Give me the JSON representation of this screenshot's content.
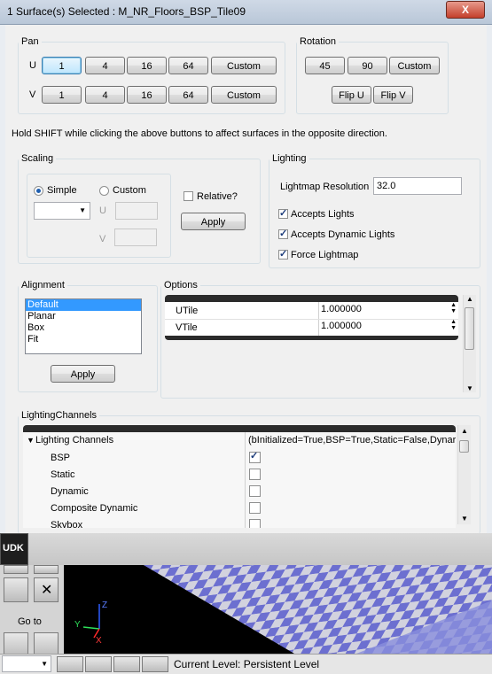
{
  "window": {
    "title": "1 Surface(s) Selected : M_NR_Floors_BSP_Tile09",
    "close_label": "X"
  },
  "pan": {
    "legend": "Pan",
    "u_label": "U",
    "v_label": "V",
    "u_buttons": [
      "1",
      "4",
      "16",
      "64",
      "Custom"
    ],
    "v_buttons": [
      "1",
      "4",
      "16",
      "64",
      "Custom"
    ]
  },
  "rotation": {
    "legend": "Rotation",
    "buttons": [
      "45",
      "90",
      "Custom"
    ],
    "flip_u": "Flip U",
    "flip_v": "Flip V"
  },
  "hint": "Hold SHIFT while clicking the above buttons to affect surfaces in the opposite direction.",
  "scaling": {
    "legend": "Scaling",
    "simple_label": "Simple",
    "custom_label": "Custom",
    "relative_label": "Relative?",
    "u_label": "U",
    "v_label": "V",
    "apply_label": "Apply",
    "mode": "Simple"
  },
  "lighting": {
    "legend": "Lighting",
    "resolution_label": "Lightmap Resolution",
    "resolution_value": "32.0",
    "accepts_lights": "Accepts Lights",
    "accepts_dynamic": "Accepts Dynamic Lights",
    "force_lightmap": "Force Lightmap"
  },
  "alignment": {
    "legend": "Alignment",
    "items": [
      "Default",
      "Planar",
      "Box",
      "Fit"
    ],
    "selected": "Default",
    "apply_label": "Apply"
  },
  "options": {
    "legend": "Options",
    "rows": [
      {
        "name": "UTile",
        "value": "1.000000"
      },
      {
        "name": "VTile",
        "value": "1.000000"
      }
    ]
  },
  "lighting_channels": {
    "legend": "LightingChannels",
    "root_label": "Lighting Channels",
    "root_value": "(bInitialized=True,BSP=True,Static=False,Dynar",
    "items": [
      {
        "name": "BSP",
        "checked": true
      },
      {
        "name": "Static",
        "checked": false
      },
      {
        "name": "Dynamic",
        "checked": false
      },
      {
        "name": "Composite Dynamic",
        "checked": false
      },
      {
        "name": "Skybox",
        "checked": false
      }
    ]
  },
  "editor": {
    "logo_label": "UDK",
    "go_to_label": "Go to",
    "axis_x": "X",
    "axis_y": "Y",
    "axis_z": "Z",
    "current_level": "Current Level:  Persistent Level"
  },
  "colors": {
    "accent": "#3399ff",
    "checker_a": "#6c6fd0",
    "checker_b": "#d2d2de"
  }
}
